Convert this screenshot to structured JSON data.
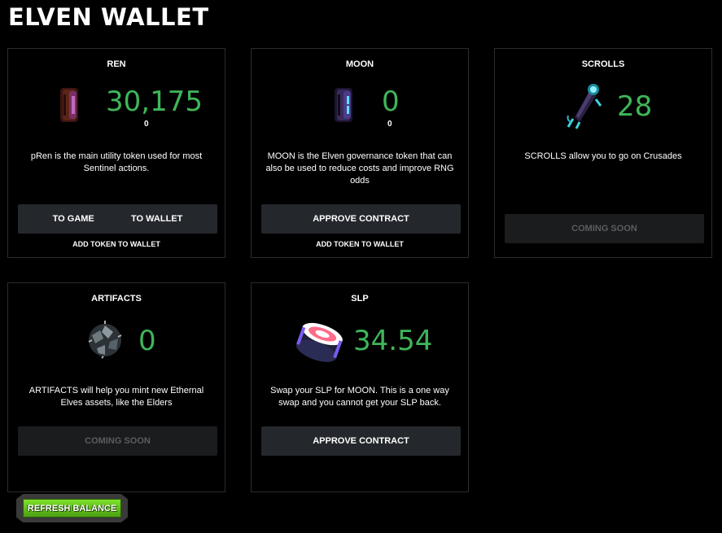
{
  "page": {
    "title": "ELVEN WALLET"
  },
  "ren": {
    "title": "REN",
    "value": "30,175",
    "sub_value": "0",
    "description": "pRen is the main utility token used for most Sentinel actions.",
    "button_left": "TO GAME",
    "button_right": "TO WALLET",
    "link": "ADD TOKEN TO WALLET"
  },
  "moon": {
    "title": "MOON",
    "value": "0",
    "sub_value": "0",
    "description": "MOON is the Elven governance token that can also be used to reduce costs and improve RNG odds",
    "button": "APPROVE CONTRACT",
    "link": "ADD TOKEN TO WALLET"
  },
  "scrolls": {
    "title": "SCROLLS",
    "value": "28",
    "description": "SCROLLS allow you to go on Crusades",
    "button": "COMING SOON"
  },
  "artifacts": {
    "title": "ARTIFACTS",
    "value": "0",
    "description": "ARTIFACTS will help you mint new Ethernal Elves assets, like the Elders",
    "button": "COMING SOON"
  },
  "slp": {
    "title": "SLP",
    "value": "34.54",
    "description": "Swap your SLP for MOON. This is a one way swap and you cannot get your SLP back.",
    "button": "APPROVE CONTRACT"
  },
  "refresh": {
    "label": "REFRESH BALANCE"
  },
  "colors": {
    "value_green": "#3fb65a",
    "button_bg": "#24272b",
    "refresh_green": "#6bcf1f"
  },
  "icons": {
    "ren": "ren-coin-icon",
    "moon": "moon-coin-icon",
    "scrolls": "scroll-creature-icon",
    "artifacts": "artifact-orb-icon",
    "slp": "slp-sushi-icon"
  }
}
